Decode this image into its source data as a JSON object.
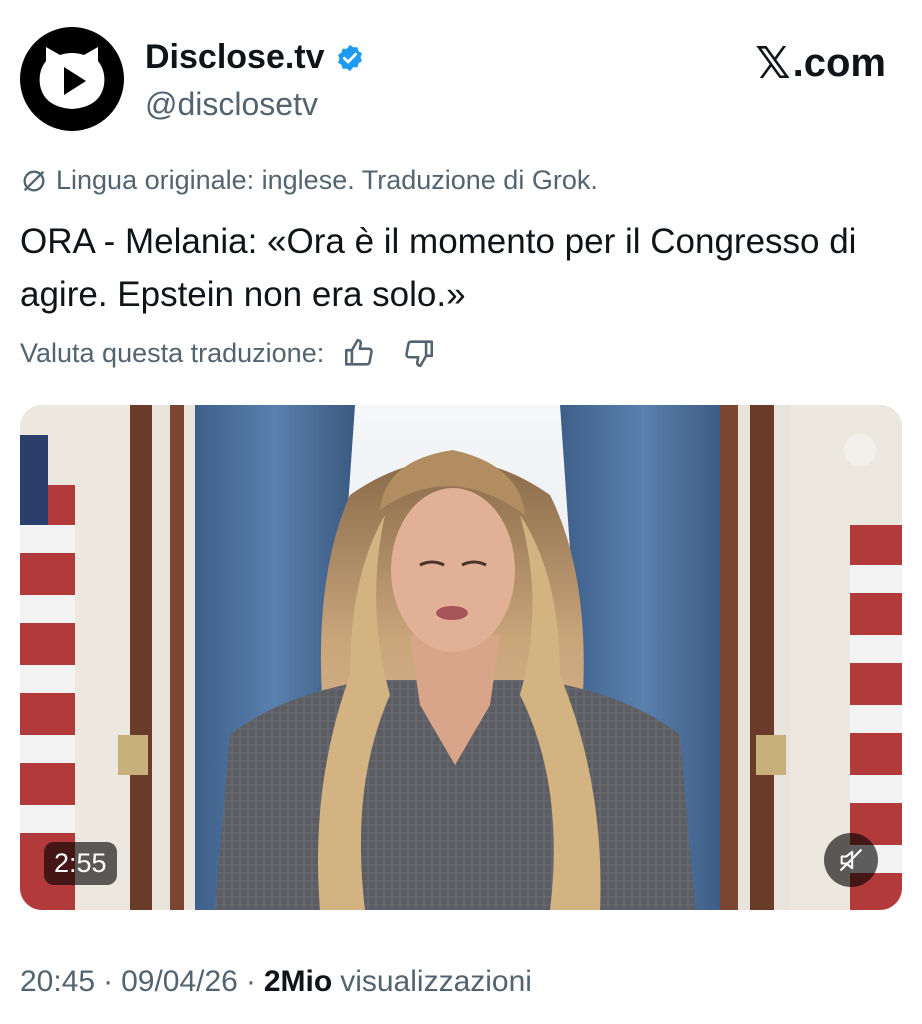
{
  "author": {
    "name": "Disclose.tv",
    "handle": "@disclosetv",
    "verified": true
  },
  "brand": {
    "logo_mark": "𝕏",
    "logo_text": ".com"
  },
  "translation": {
    "note": "Lingua originale: inglese. Traduzione di Grok.",
    "rate_label": "Valuta questa traduzione:"
  },
  "tweet": {
    "text": "ORA - Melania: «Ora è il momento per il Congresso di agire. Epstein non era solo.»"
  },
  "video": {
    "duration": "2:55",
    "muted": true
  },
  "meta": {
    "time": "20:45",
    "separator": "·",
    "date": "09/04/26",
    "views_count": "2Mio",
    "views_label": "visualizzazioni"
  },
  "colors": {
    "text_primary": "#0f1419",
    "text_secondary": "#536471",
    "verified_blue": "#1d9bf0"
  },
  "icons": {
    "avatar": "play-cat-logo-icon",
    "verified": "verified-badge-icon",
    "translation": "slash-circle-icon",
    "thumbs_up": "thumbs-up-icon",
    "thumbs_down": "thumbs-down-icon",
    "mute": "speaker-muted-icon"
  }
}
